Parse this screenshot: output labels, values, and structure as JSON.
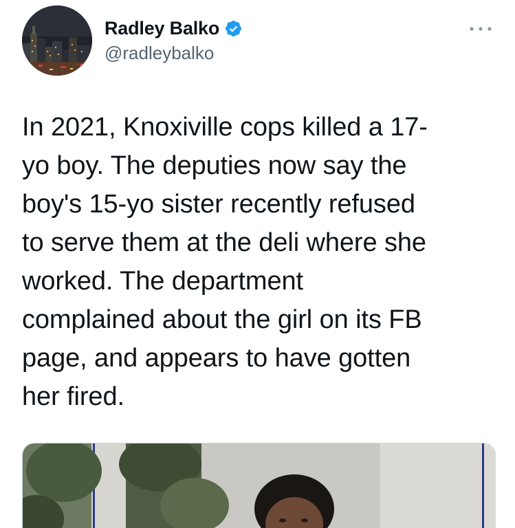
{
  "tweet": {
    "author": {
      "display_name": "Radley Balko",
      "handle": "@radleybalko",
      "verified": true,
      "verified_icon": "verified-badge-icon",
      "avatar_icon": "city-night-skyline-avatar"
    },
    "more_icon": "more-options-icon",
    "text": "In 2021, Knoxiville cops killed a 17-\nyo boy. The deputies now say the\nboy's 15-yo sister recently refused\nto serve them at the deli where she\nworked. The department\ncomplained about the girl on its FB\npage, and appears to have gotten\nher fired.",
    "media_icon": "photo-woman-in-front-of-plant"
  },
  "colors": {
    "text_primary": "#0f1419",
    "text_secondary": "#536471",
    "verified_blue": "#1d9bf0",
    "border": "#cfd9de"
  }
}
